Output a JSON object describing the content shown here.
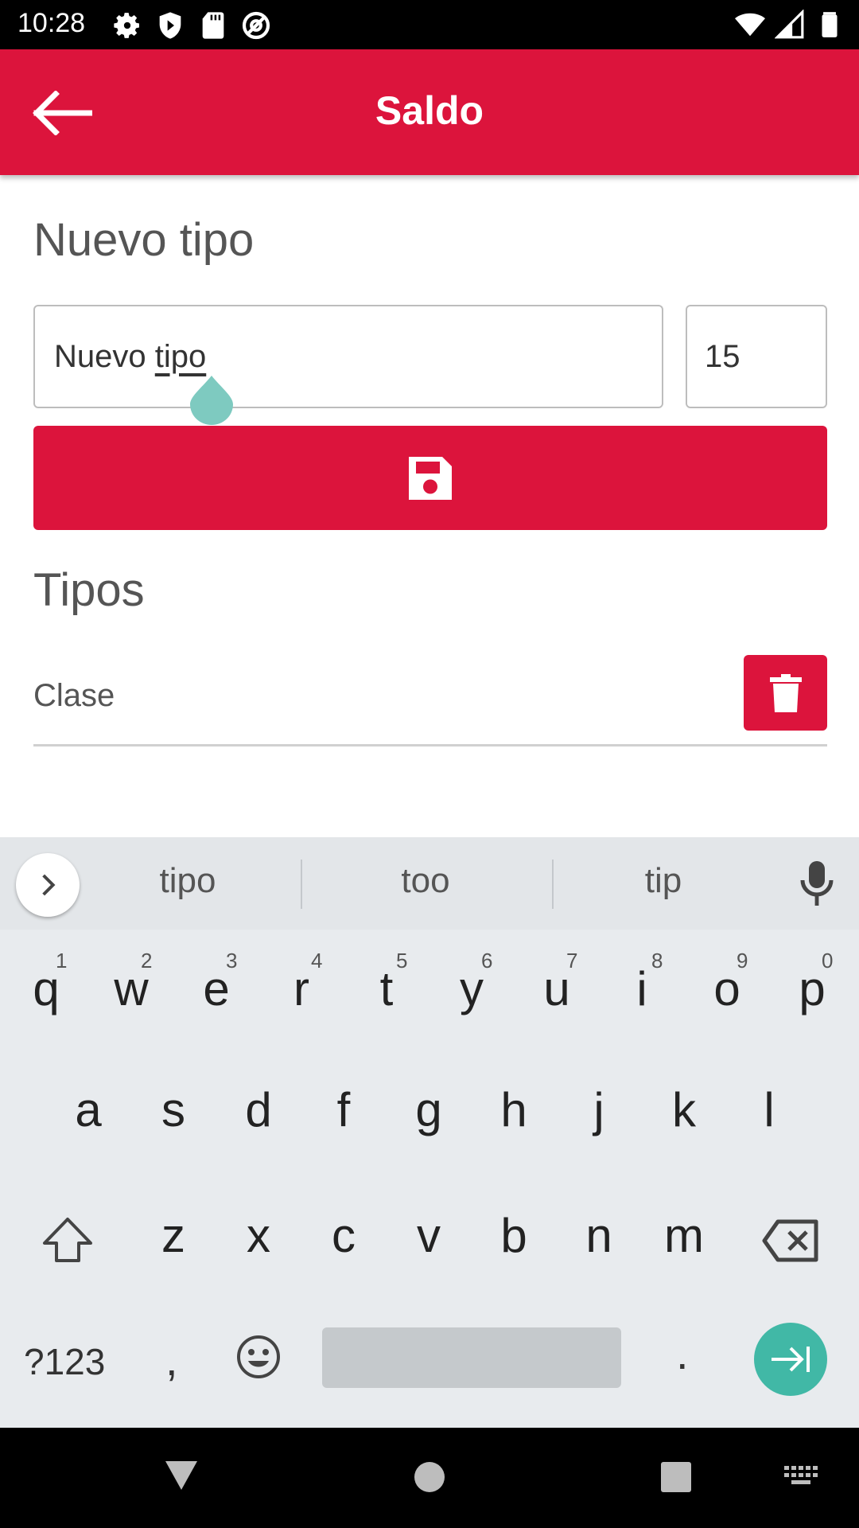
{
  "status_bar": {
    "time": "10:28"
  },
  "app_bar": {
    "title": "Saldo"
  },
  "form": {
    "heading": "Nuevo tipo",
    "name_value_prefix": "Nuevo ",
    "name_value_word": "tipo",
    "quantity_value": "15"
  },
  "types": {
    "heading": "Tipos",
    "items": [
      {
        "label": "Clase"
      }
    ]
  },
  "keyboard": {
    "suggestions": [
      "tipo",
      "too",
      "tip"
    ],
    "row1": [
      "q",
      "w",
      "e",
      "r",
      "t",
      "y",
      "u",
      "i",
      "o",
      "p"
    ],
    "row1_hints": [
      "1",
      "2",
      "3",
      "4",
      "5",
      "6",
      "7",
      "8",
      "9",
      "0"
    ],
    "row2": [
      "a",
      "s",
      "d",
      "f",
      "g",
      "h",
      "j",
      "k",
      "l"
    ],
    "row3": [
      "z",
      "x",
      "c",
      "v",
      "b",
      "n",
      "m"
    ],
    "symbols_label": "?123",
    "comma_label": ",",
    "period_label": "."
  },
  "colors": {
    "accent": "#dc143c",
    "keyboard_enter": "#41b8a6",
    "cursor_handle": "#7ecac0"
  }
}
